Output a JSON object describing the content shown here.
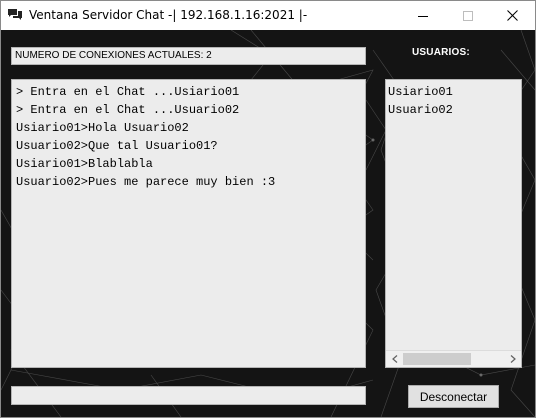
{
  "window": {
    "title": "Ventana Servidor Chat -| 192.168.1.16:2021 |-"
  },
  "connections": {
    "label": "NUMERO DE CONEXIONES ACTUALES: 2"
  },
  "users": {
    "title": "USUARIOS:",
    "items": [
      "Usiario01",
      "Usuario02"
    ]
  },
  "chat": {
    "lines": [
      "> Entra en el Chat ...Usiario01",
      "> Entra en el Chat ...Usuario02",
      "Usiario01>Hola Usuario02",
      "Usuario02>Que tal Usuario01?",
      "Usiario01>Blablabla",
      "Usuario02>Pues me parece muy bien :3"
    ]
  },
  "message_input": {
    "value": ""
  },
  "buttons": {
    "disconnect": "Desconectar"
  },
  "colors": {
    "background": "#141414",
    "text_area": "#ececec",
    "button": "#e1e1e1"
  }
}
